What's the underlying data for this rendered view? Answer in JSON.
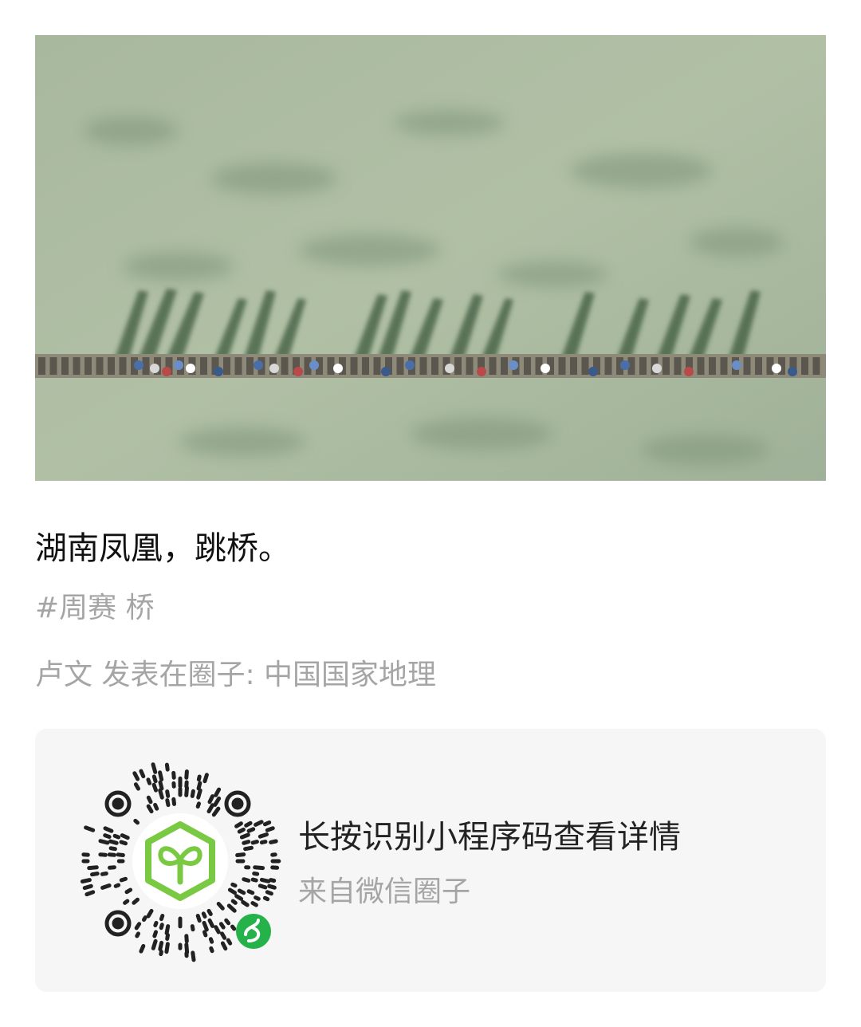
{
  "post": {
    "title": "湖南凤凰，跳桥。",
    "tag": "#周赛 桥",
    "meta": "卢文 发表在圈子: 中国国家地理"
  },
  "mini_program_card": {
    "main_text": "长按识别小程序码查看详情",
    "sub_text": "来自微信圈子"
  },
  "icons": {
    "photo": "aerial-river-stone-bridge-photo",
    "qr": "wechat-mini-program-code-icon",
    "logo": "sprout-box-logo-icon",
    "link": "mini-program-link-icon"
  },
  "colors": {
    "title": "#111111",
    "secondary_text": "#a5a5a5",
    "card_background": "#f6f6f6",
    "accent_green": "#7ac943",
    "badge_green": "#25b24a"
  }
}
